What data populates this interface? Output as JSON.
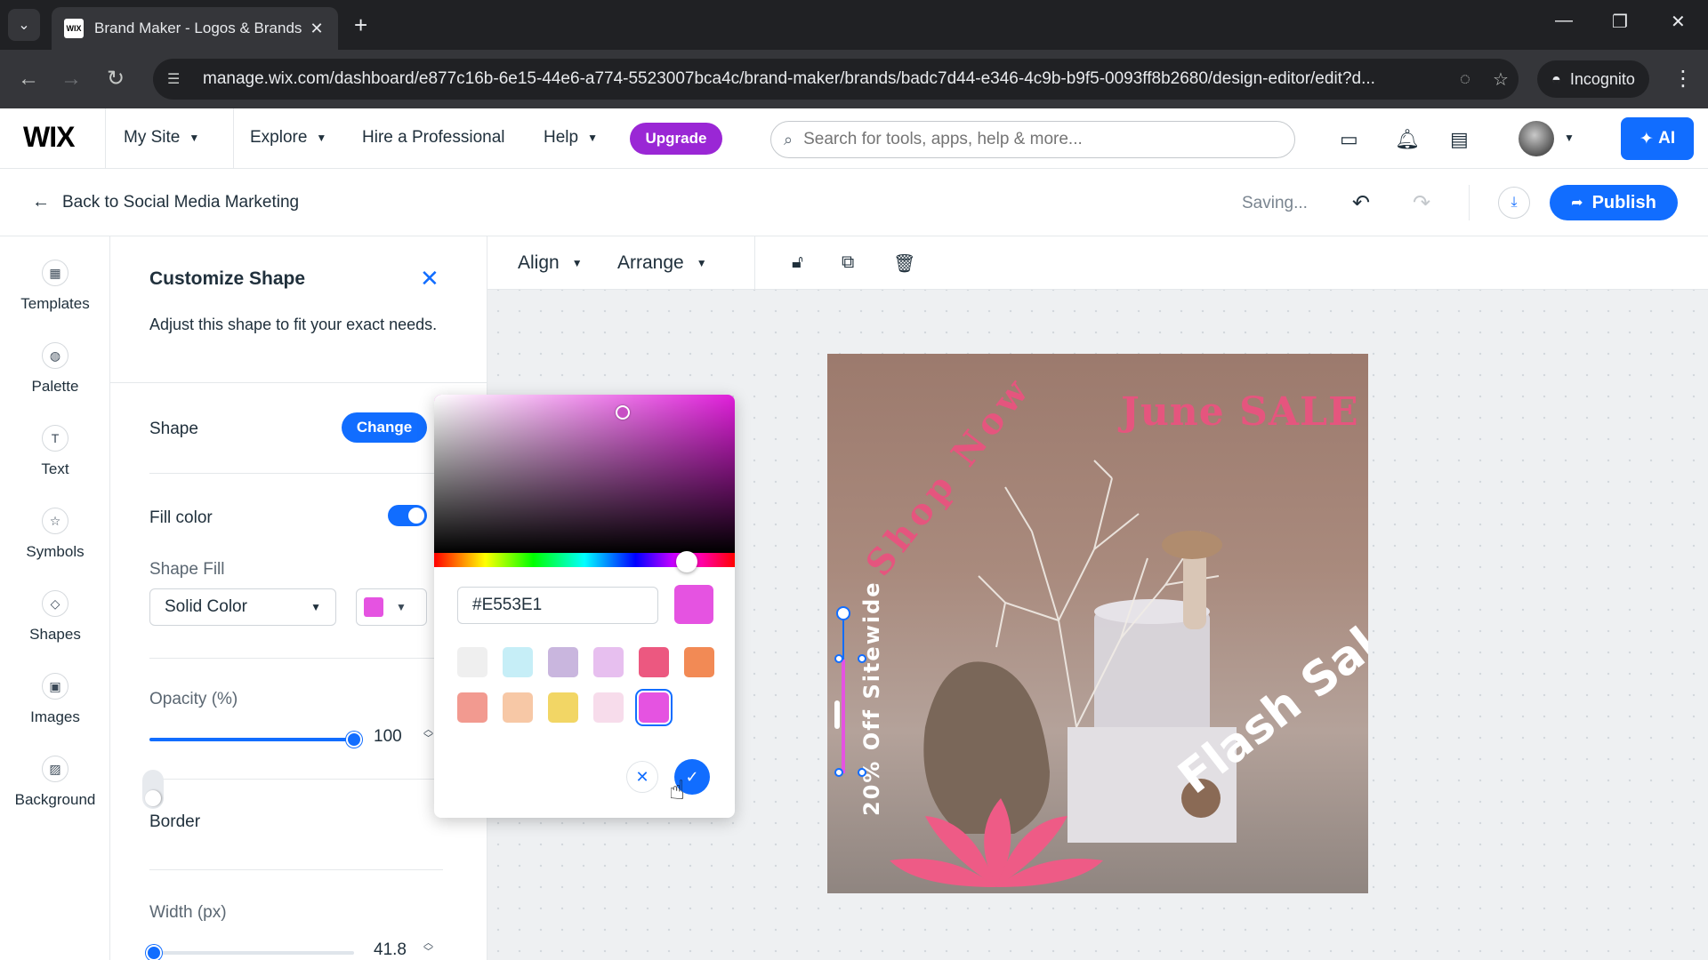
{
  "browser": {
    "tab_title": "Brand Maker - Logos & Brands",
    "favicon_text": "WIX",
    "url": "manage.wix.com/dashboard/e877c16b-6e15-44e6-a774-5523007bca4c/brand-maker/brands/badc7d44-e346-4c9b-b9f5-0093ff8b2680/design-editor/edit?d...",
    "incognito_label": "Incognito"
  },
  "wix_header": {
    "logo": "WIX",
    "nav": {
      "my_site": "My Site",
      "explore": "Explore",
      "hire": "Hire a Professional",
      "help": "Help"
    },
    "upgrade_label": "Upgrade",
    "search_placeholder": "Search for tools, apps, help & more...",
    "ai_label": "AI"
  },
  "editor_header": {
    "back_label": "Back to Social Media Marketing",
    "status": "Saving...",
    "publish_label": "Publish"
  },
  "rail": {
    "items": [
      {
        "label": "Templates",
        "icon": "templates-icon"
      },
      {
        "label": "Palette",
        "icon": "palette-icon"
      },
      {
        "label": "Text",
        "icon": "text-icon"
      },
      {
        "label": "Symbols",
        "icon": "symbols-icon"
      },
      {
        "label": "Shapes",
        "icon": "shapes-icon"
      },
      {
        "label": "Images",
        "icon": "images-icon"
      },
      {
        "label": "Background",
        "icon": "background-icon"
      }
    ]
  },
  "panel": {
    "title": "Customize Shape",
    "description": "Adjust this shape to fit your exact needs.",
    "shape_label": "Shape",
    "change_label": "Change",
    "fill_color_label": "Fill color",
    "fill_color_enabled": true,
    "shape_fill_label": "Shape Fill",
    "shape_fill_value": "Solid Color",
    "fill_swatch_color": "#E553E1",
    "opacity_label": "Opacity (%)",
    "opacity_value": "100",
    "border_label": "Border",
    "border_enabled": false,
    "width_label": "Width (px)",
    "width_value": "41.8"
  },
  "color_picker": {
    "hex_value": "#E553E1",
    "presets": [
      {
        "color": "#EFEFEF"
      },
      {
        "color": "#C6EEF7"
      },
      {
        "color": "#C9B6DE"
      },
      {
        "color": "#E7BFEF"
      },
      {
        "color": "#EC5880"
      },
      {
        "color": "#F28A55"
      },
      {
        "color": "#F29A90"
      },
      {
        "color": "#F7C8A6"
      },
      {
        "color": "#F2D665"
      },
      {
        "color": "#F7DCEB"
      },
      {
        "color": "#E553E1",
        "selected": true
      }
    ]
  },
  "canvas_toolbar": {
    "align_label": "Align",
    "arrange_label": "Arrange"
  },
  "design": {
    "june_sale": "June SALE",
    "shop_now": "Shop Now",
    "flash_sale": "Flash Sale",
    "sitewide": "20% Off Sitewide",
    "accent_color": "#E5557E"
  }
}
